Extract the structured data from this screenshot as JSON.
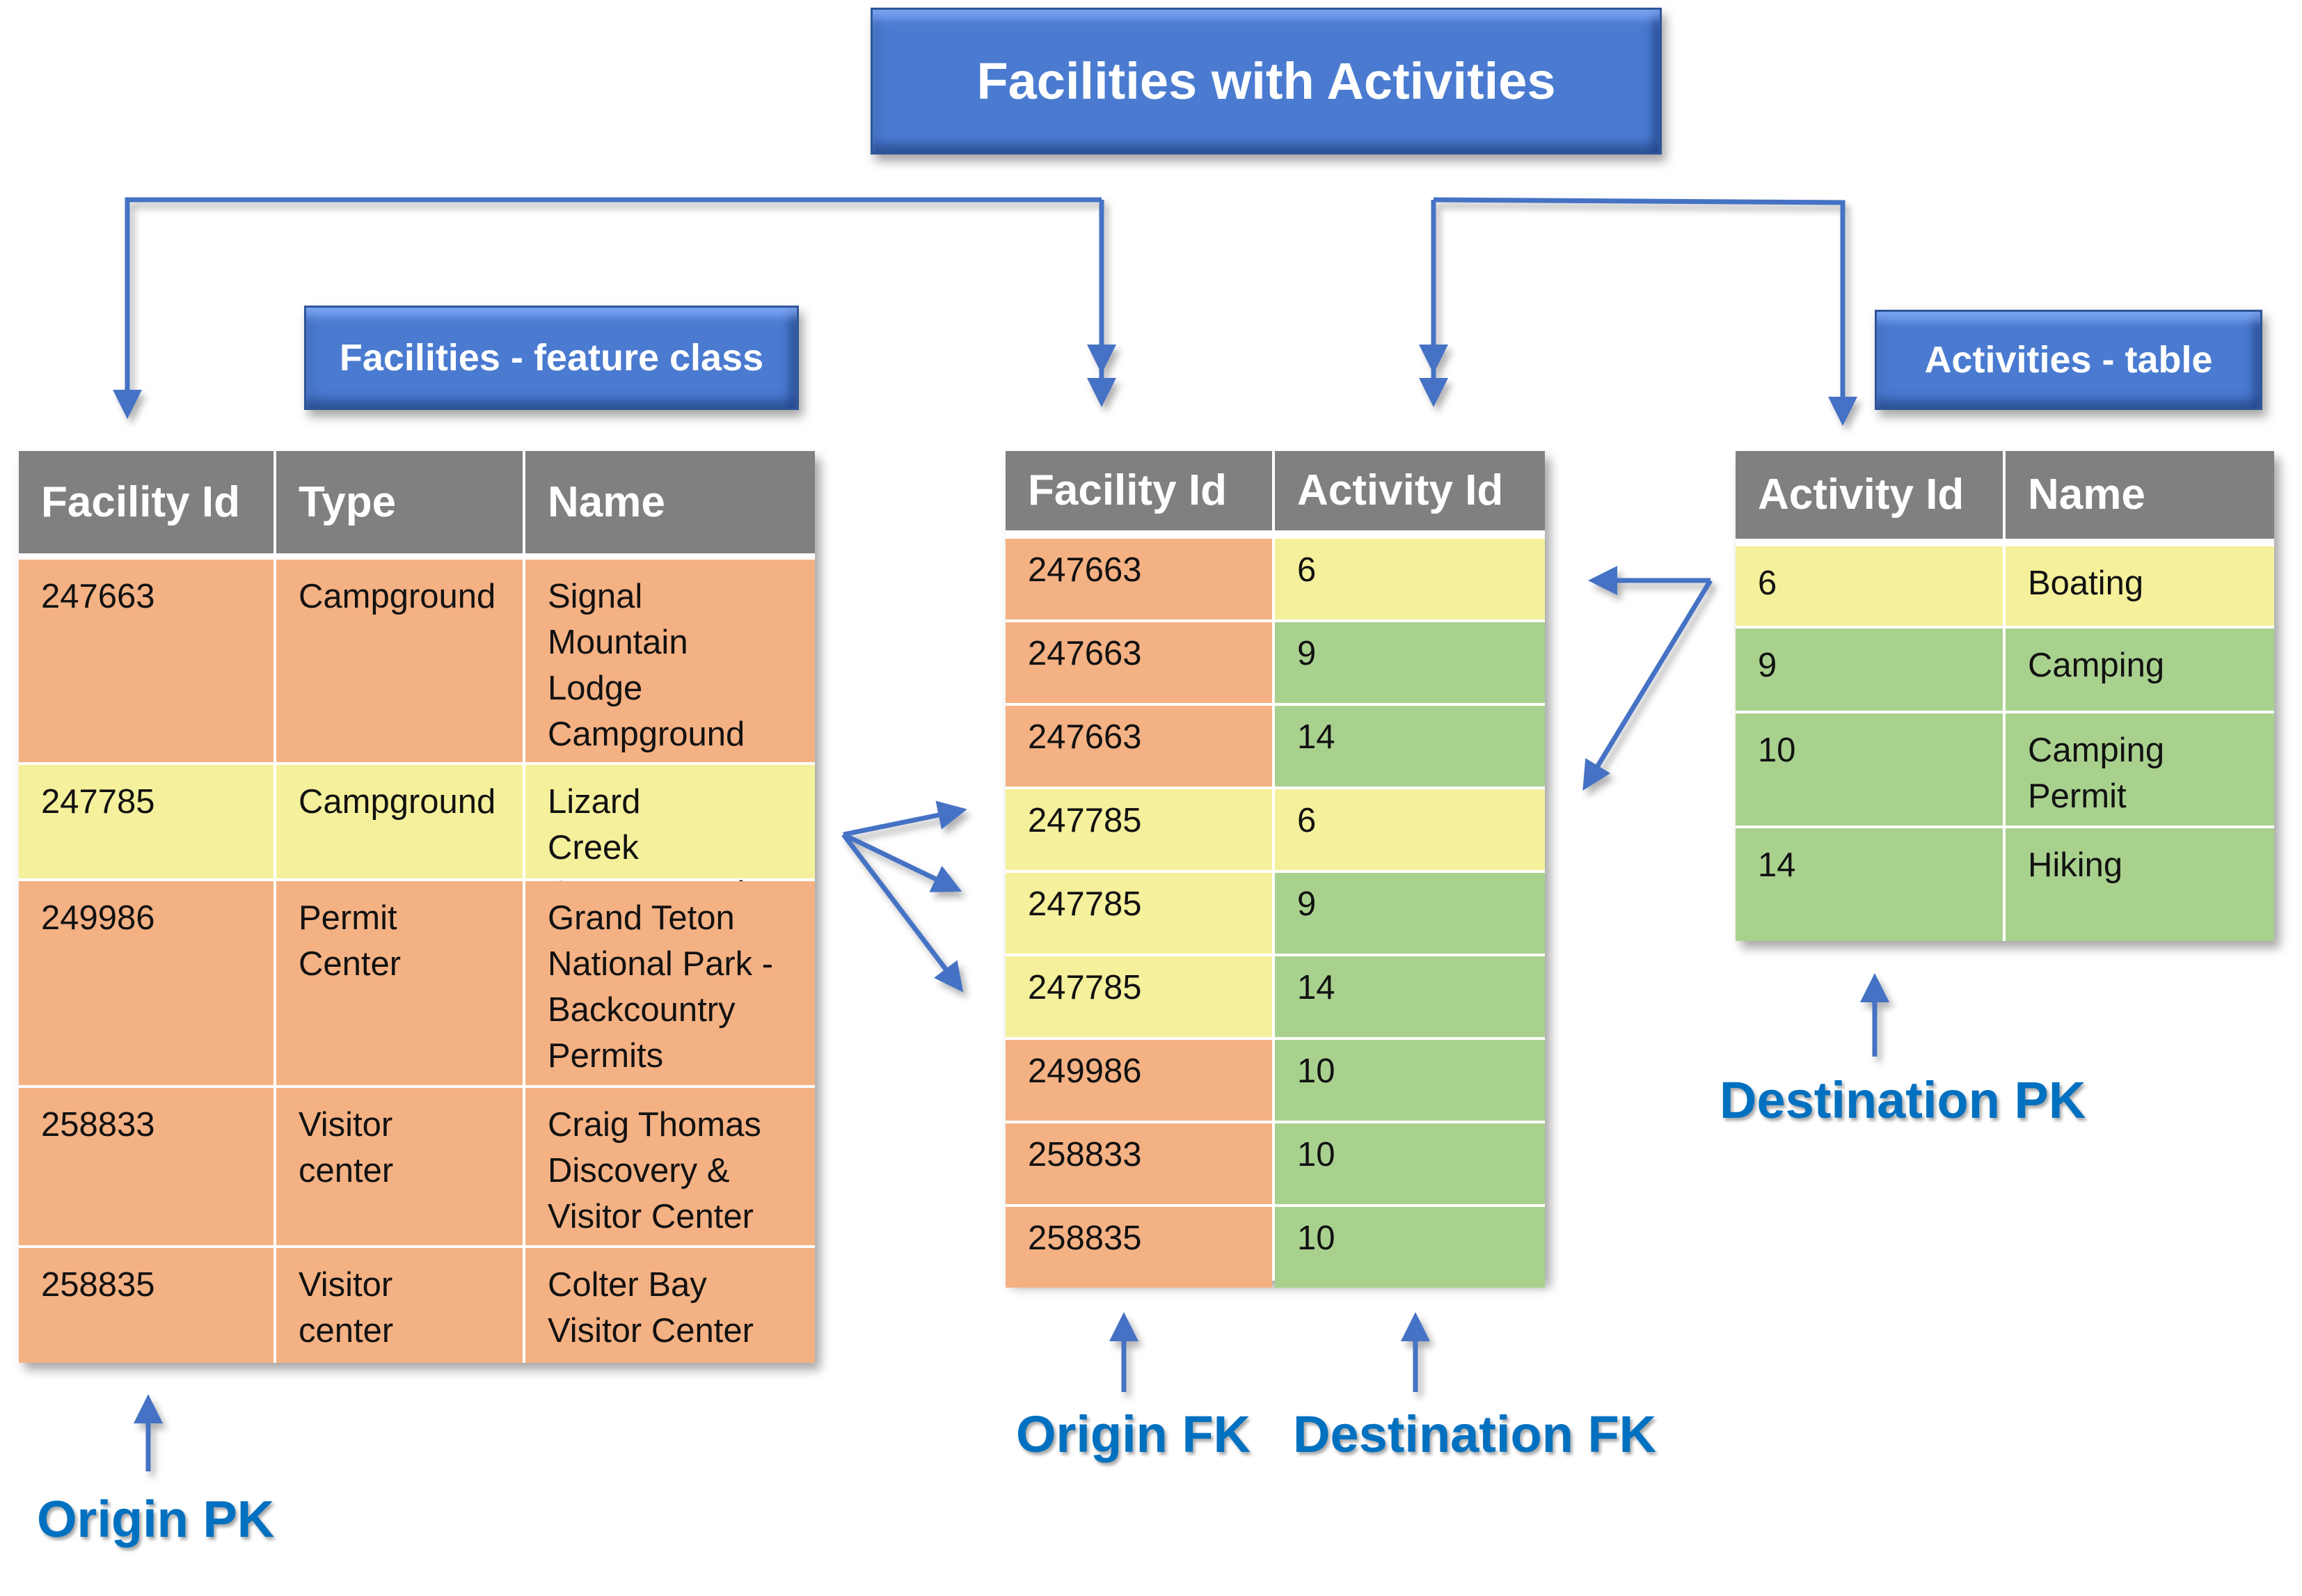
{
  "diagram": {
    "title": "Facilities with Activities",
    "colors": {
      "title_box": "#4a7bd0",
      "arrow": "#4472c4",
      "header": "#808080",
      "orange": "#f4b183",
      "yellow": "#f5f09b",
      "green": "#a9d18e",
      "key_label": "#0070c0"
    }
  },
  "facilities": {
    "label": "Facilities - feature class",
    "columns": [
      "Facility Id",
      "Type",
      "Name"
    ],
    "rows": [
      {
        "id": "247663",
        "type": "Campground",
        "name": "Signal Mountain Lodge Campground",
        "color": "orange"
      },
      {
        "id": "247785",
        "type": "Campground",
        "name": "Lizard Creek Campground",
        "color": "yellow"
      },
      {
        "id": "249986",
        "type": "Permit Center",
        "name": "Grand Teton National Park - Backcountry Permits",
        "color": "orange"
      },
      {
        "id": "258833",
        "type": "Visitor center",
        "name": "Craig Thomas Discovery & Visitor Center",
        "color": "orange"
      },
      {
        "id": "258835",
        "type": "Visitor center",
        "name": "Colter Bay Visitor Center",
        "color": "orange"
      }
    ]
  },
  "relationship": {
    "columns": [
      "Facility Id",
      "Activity Id"
    ],
    "rows": [
      {
        "facility_id": "247663",
        "activity_id": "6",
        "fcolor": "orange",
        "acolor": "yellow"
      },
      {
        "facility_id": "247663",
        "activity_id": "9",
        "fcolor": "orange",
        "acolor": "green"
      },
      {
        "facility_id": "247663",
        "activity_id": "14",
        "fcolor": "orange",
        "acolor": "green"
      },
      {
        "facility_id": "247785",
        "activity_id": "6",
        "fcolor": "yellow",
        "acolor": "yellow"
      },
      {
        "facility_id": "247785",
        "activity_id": "9",
        "fcolor": "yellow",
        "acolor": "green"
      },
      {
        "facility_id": "247785",
        "activity_id": "14",
        "fcolor": "yellow",
        "acolor": "green"
      },
      {
        "facility_id": "249986",
        "activity_id": "10",
        "fcolor": "orange",
        "acolor": "green"
      },
      {
        "facility_id": "258833",
        "activity_id": "10",
        "fcolor": "orange",
        "acolor": "green"
      },
      {
        "facility_id": "258835",
        "activity_id": "10",
        "fcolor": "orange",
        "acolor": "green"
      }
    ]
  },
  "activities": {
    "label": "Activities - table",
    "columns": [
      "Activity Id",
      "Name"
    ],
    "rows": [
      {
        "id": "6",
        "name": "Boating",
        "color": "yellow"
      },
      {
        "id": "9",
        "name": "Camping",
        "color": "green"
      },
      {
        "id": "10",
        "name": "Camping Permit",
        "color": "green"
      },
      {
        "id": "14",
        "name": "Hiking",
        "color": "green"
      }
    ]
  },
  "key_labels": {
    "origin_pk": "Origin PK",
    "origin_fk": "Origin FK",
    "destination_fk": "Destination FK",
    "destination_pk": "Destination PK"
  }
}
